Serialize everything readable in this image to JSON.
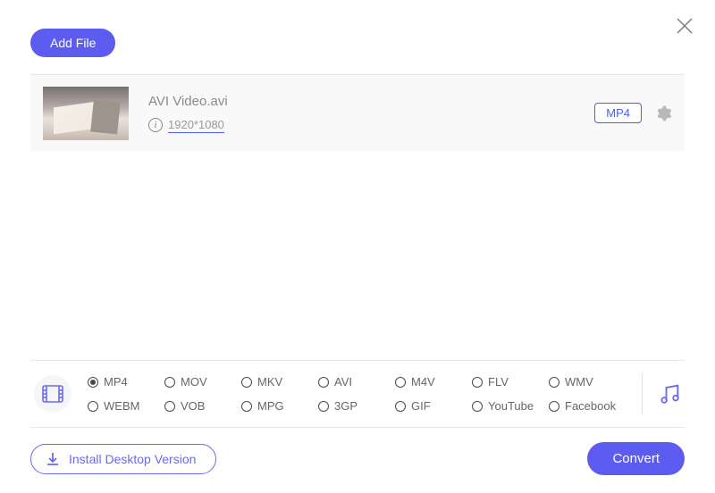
{
  "header": {
    "add_file_label": "Add File"
  },
  "file": {
    "name": "AVI Video.avi",
    "resolution": "1920*1080",
    "output_format": "MP4"
  },
  "formats": {
    "selected": "MP4",
    "options": [
      "MP4",
      "MOV",
      "MKV",
      "AVI",
      "M4V",
      "FLV",
      "WMV",
      "WEBM",
      "VOB",
      "MPG",
      "3GP",
      "GIF",
      "YouTube",
      "Facebook"
    ]
  },
  "footer": {
    "install_label": "Install Desktop Version",
    "convert_label": "Convert"
  },
  "colors": {
    "accent": "#5d5cf1"
  }
}
